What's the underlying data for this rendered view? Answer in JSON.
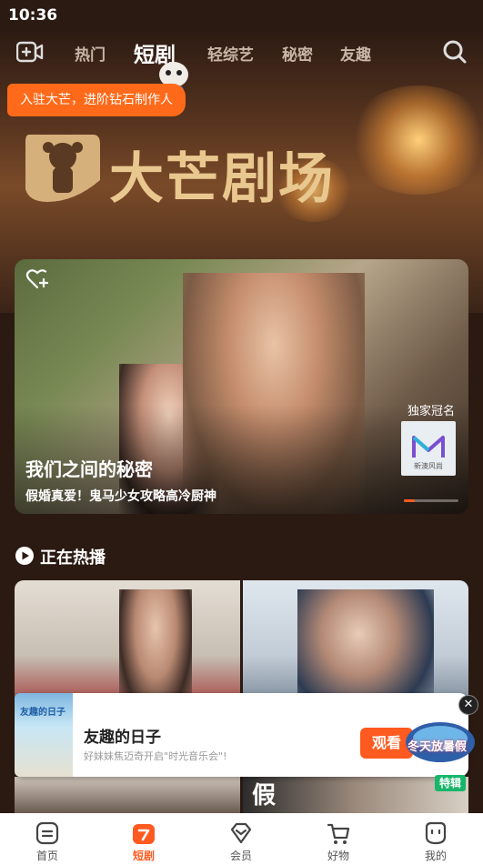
{
  "status_bar": {
    "time": "10:36"
  },
  "top_nav": {
    "tabs": [
      {
        "label": "热门"
      },
      {
        "label": "短剧"
      },
      {
        "label": "轻综艺"
      },
      {
        "label": "秘密"
      },
      {
        "label": "友趣"
      }
    ],
    "active_tab": "短剧"
  },
  "promo_banner": {
    "text": "入驻大芒，进阶钻石制作人"
  },
  "brand": {
    "title": "大芒剧场"
  },
  "featured": {
    "title": "我们之间的秘密",
    "subtitle": "假婚真爱！鬼马少女攻略高冷厨神",
    "sponsor_label": "独家冠名",
    "sponsor_brand": "新澳风尚",
    "carousel_progress": 0.2
  },
  "section": {
    "title": "正在热播"
  },
  "mini_player": {
    "poster_text": "友趣的日子",
    "title": "友趣的日子",
    "subtitle": "好妹妹焦迈奇开启\"时光音乐会\"!",
    "watch_label": "观看",
    "close_glyph": "✕"
  },
  "winter_badge": {
    "text": "冬天放暑假",
    "tag": "特辑"
  },
  "row2": {
    "poster_text": "假"
  },
  "bottom_tabs": [
    {
      "label": "首页",
      "icon": "home-icon"
    },
    {
      "label": "短剧",
      "icon": "short-drama-icon"
    },
    {
      "label": "会员",
      "icon": "vip-diamond-icon"
    },
    {
      "label": "好物",
      "icon": "cart-icon"
    },
    {
      "label": "我的",
      "icon": "profile-icon"
    }
  ],
  "colors": {
    "accent": "#ff5a1f",
    "brand_gold": "#e9c88f",
    "background": "#2a1a12"
  }
}
